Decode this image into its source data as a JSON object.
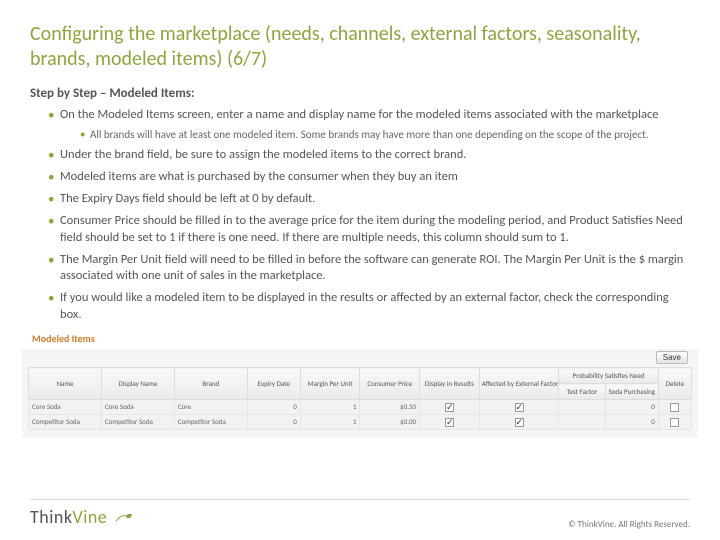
{
  "title": "Configuring the marketplace (needs, channels, external factors, seasonality, brands, modeled items) (6/7)",
  "heading": "Step by Step – Modeled Items:",
  "bullets": [
    {
      "text": "On the Modeled Items screen, enter a name and display name for the modeled items associated with the marketplace",
      "sub": [
        "All brands will have at least one modeled item.  Some brands may have more than one depending on the scope of the project."
      ]
    },
    {
      "text": "Under the brand field, be sure to assign the modeled items to the correct brand."
    },
    {
      "text": "Modeled items are what is purchased by the consumer when they buy an item"
    },
    {
      "text": "The Expiry Days field should be left at 0 by default."
    },
    {
      "text": "Consumer Price should be filled in to the average price for the item during the modeling period, and Product Satisfies Need field should be set to 1 if there is one need.  If there are multiple needs, this column should sum to 1."
    },
    {
      "text": "The Margin Per Unit field will need to be filled in before the software can generate ROI.  The Margin Per Unit is the $ margin associated with one unit of sales in the marketplace."
    },
    {
      "text": "If you would like a modeled item to be displayed in the results or affected by an external factor, check the corresponding box."
    }
  ],
  "panelLabel": "Modeled Items",
  "save": "Save",
  "table": {
    "headers": [
      "Name",
      "Display Name",
      "Brand",
      "Expiry Date",
      "Margin Per Unit",
      "Consumer Price",
      "Display in Results",
      "Affected by External Factors",
      "Probability Satisfies Need",
      "",
      "Delete"
    ],
    "subheaders": [
      "",
      "",
      "",
      "",
      "",
      "",
      "",
      "",
      "Test Factor",
      "Soda Purchasing",
      ""
    ],
    "rows": [
      {
        "name": "Core Soda",
        "display": "Core Soda",
        "brand": "Core",
        "expiry": "0",
        "margin": "1",
        "price": "$0.50",
        "disp": true,
        "ext": true,
        "prob": "0",
        "del": false
      },
      {
        "name": "Competitor Soda",
        "display": "Competitor Soda",
        "brand": "Competitor Soda",
        "expiry": "0",
        "margin": "1",
        "price": "$0.00",
        "disp": true,
        "ext": true,
        "prob": "0",
        "del": false
      }
    ]
  },
  "logo": {
    "think": "Think",
    "vine": "Vine"
  },
  "copyright": "© ThinkVine.  All Rights Reserved."
}
